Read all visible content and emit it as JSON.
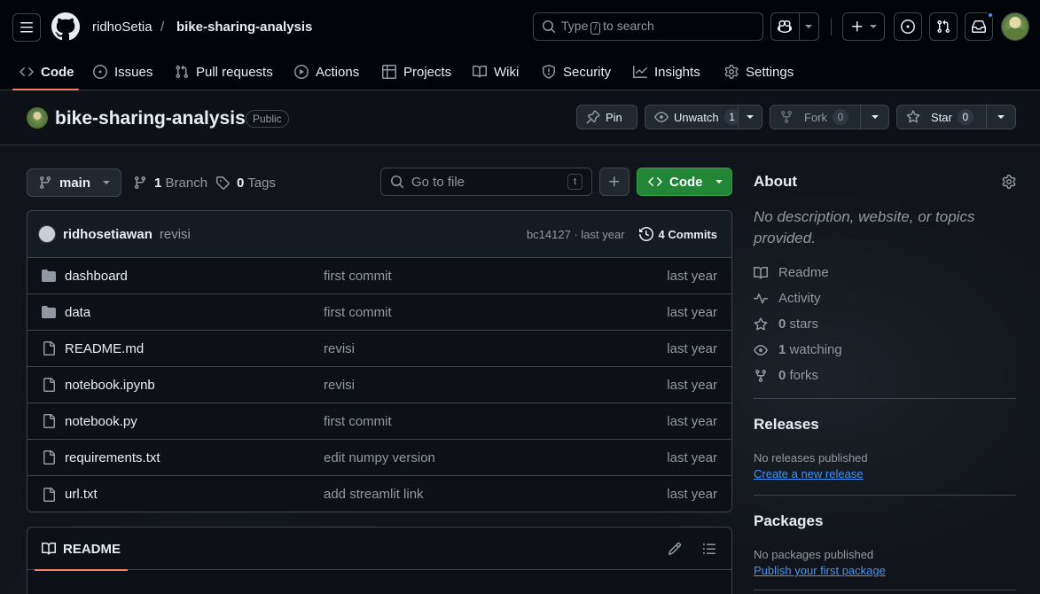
{
  "header": {
    "owner": "ridhoSetia",
    "separator": "/",
    "repo": "bike-sharing-analysis",
    "search_before": "Type",
    "search_key": "/",
    "search_after": "to search"
  },
  "tabs": [
    {
      "label": "Code",
      "icon": "code-icon",
      "active": true
    },
    {
      "label": "Issues",
      "icon": "issue-icon"
    },
    {
      "label": "Pull requests",
      "icon": "pull-request-icon"
    },
    {
      "label": "Actions",
      "icon": "play-icon"
    },
    {
      "label": "Projects",
      "icon": "table-icon"
    },
    {
      "label": "Wiki",
      "icon": "book-icon"
    },
    {
      "label": "Security",
      "icon": "shield-icon"
    },
    {
      "label": "Insights",
      "icon": "graph-icon"
    },
    {
      "label": "Settings",
      "icon": "gear-icon"
    }
  ],
  "repo": {
    "name": "bike-sharing-analysis",
    "visibility": "Public",
    "pin_label": "Pin",
    "unwatch_label": "Unwatch",
    "watch_count": "1",
    "fork_label": "Fork",
    "fork_count": "0",
    "star_label": "Star",
    "star_count": "0"
  },
  "toolbar": {
    "branch": "main",
    "branch_count": "1",
    "branch_label": "Branch",
    "tag_count": "0",
    "tag_label": "Tags",
    "goto_placeholder": "Go to file",
    "goto_key": "t",
    "code_label": "Code"
  },
  "commit": {
    "author": "ridhosetiawan",
    "message": "revisi",
    "hash_time": "bc14127 · last year",
    "commits_label": "4 Commits"
  },
  "files": [
    {
      "type": "folder",
      "name": "dashboard",
      "message": "first commit",
      "age": "last year"
    },
    {
      "type": "folder",
      "name": "data",
      "message": "first commit",
      "age": "last year"
    },
    {
      "type": "file",
      "name": "README.md",
      "message": "revisi",
      "age": "last year"
    },
    {
      "type": "file",
      "name": "notebook.ipynb",
      "message": "revisi",
      "age": "last year"
    },
    {
      "type": "file",
      "name": "notebook.py",
      "message": "first commit",
      "age": "last year"
    },
    {
      "type": "file",
      "name": "requirements.txt",
      "message": "edit numpy version",
      "age": "last year"
    },
    {
      "type": "file",
      "name": "url.txt",
      "message": "add streamlit link",
      "age": "last year"
    }
  ],
  "readme": {
    "tab_label": "README"
  },
  "about": {
    "title": "About",
    "description": "No description, website, or topics provided.",
    "readme_label": "Readme",
    "activity_label": "Activity",
    "stars_count": "0",
    "stars_label": "stars",
    "watching_count": "1",
    "watching_label": "watching",
    "forks_count": "0",
    "forks_label": "forks"
  },
  "releases": {
    "title": "Releases",
    "empty": "No releases published",
    "link": "Create a new release"
  },
  "packages": {
    "title": "Packages",
    "empty": "No packages published",
    "link": "Publish your first package"
  },
  "colors": {
    "accent_green": "#238636",
    "tab_underline": "#f78166",
    "link_blue": "#4493f8"
  }
}
